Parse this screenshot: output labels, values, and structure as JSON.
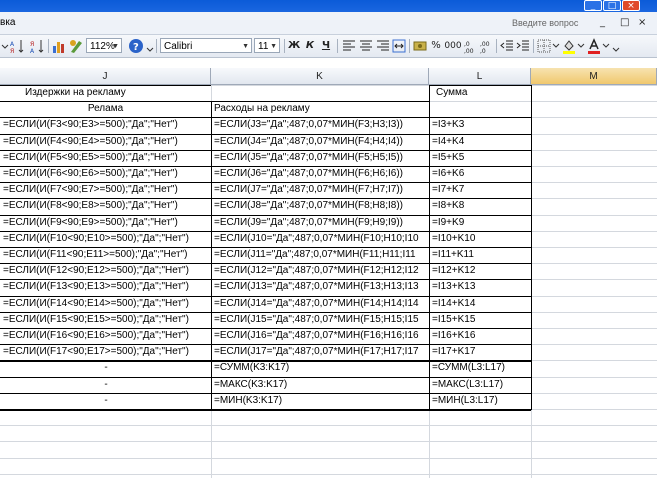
{
  "window": {
    "menu_partial_label": "вка",
    "min": "_",
    "max": "□",
    "close": "×"
  },
  "menubar": {
    "help_placeholder": "Введите вопрос",
    "doc_min": "_",
    "doc_restore": "□",
    "doc_close": "×"
  },
  "toolbar": {
    "zoom": "112%",
    "font_name": "Calibri",
    "font_size": "11",
    "bold": "Ж",
    "italic": "К",
    "underline": "Ч",
    "percent": "%",
    "thousands": "000",
    "help_glyph": "?"
  },
  "columns": [
    {
      "letter": "J"
    },
    {
      "letter": "K"
    },
    {
      "letter": "L"
    },
    {
      "letter": "M"
    }
  ],
  "header_rows": {
    "j1": "Издержки на рекламу",
    "l1": "Сумма",
    "j2": "Релама",
    "k2": "Расходы на рекламу"
  },
  "rows": [
    {
      "j": "=ЕСЛИ(И(F3<90;E3>=500);\"Да\";\"Нет\")",
      "k": "=ЕСЛИ(J3=\"Да\";487;0,07*МИН(F3;H3;I3))",
      "l": "=I3+K3"
    },
    {
      "j": "=ЕСЛИ(И(F4<90;E4>=500);\"Да\";\"Нет\")",
      "k": "=ЕСЛИ(J4=\"Да\";487;0,07*МИН(F4;H4;I4))",
      "l": "=I4+K4"
    },
    {
      "j": "=ЕСЛИ(И(F5<90;E5>=500);\"Да\";\"Нет\")",
      "k": "=ЕСЛИ(J5=\"Да\";487;0,07*МИН(F5;H5;I5))",
      "l": "=I5+K5"
    },
    {
      "j": "=ЕСЛИ(И(F6<90;E6>=500);\"Да\";\"Нет\")",
      "k": "=ЕСЛИ(J6=\"Да\";487;0,07*МИН(F6;H6;I6))",
      "l": "=I6+K6"
    },
    {
      "j": "=ЕСЛИ(И(F7<90;E7>=500);\"Да\";\"Нет\")",
      "k": "=ЕСЛИ(J7=\"Да\";487;0,07*МИН(F7;H7;I7))",
      "l": "=I7+K7"
    },
    {
      "j": "=ЕСЛИ(И(F8<90;E8>=500);\"Да\";\"Нет\")",
      "k": "=ЕСЛИ(J8=\"Да\";487;0,07*МИН(F8;H8;I8))",
      "l": "=I8+K8"
    },
    {
      "j": "=ЕСЛИ(И(F9<90;E9>=500);\"Да\";\"Нет\")",
      "k": "=ЕСЛИ(J9=\"Да\";487;0,07*МИН(F9;H9;I9))",
      "l": "=I9+K9"
    },
    {
      "j": "=ЕСЛИ(И(F10<90;E10>=500);\"Да\";\"Нет\")",
      "k": "=ЕСЛИ(J10=\"Да\";487;0,07*МИН(F10;H10;I10",
      "l": "=I10+K10"
    },
    {
      "j": "=ЕСЛИ(И(F11<90;E11>=500);\"Да\";\"Нет\")",
      "k": "=ЕСЛИ(J11=\"Да\";487;0,07*МИН(F11;H11;I11",
      "l": "=I11+K11"
    },
    {
      "j": "=ЕСЛИ(И(F12<90;E12>=500);\"Да\";\"Нет\")",
      "k": "=ЕСЛИ(J12=\"Да\";487;0,07*МИН(F12;H12;I12",
      "l": "=I12+K12"
    },
    {
      "j": "=ЕСЛИ(И(F13<90;E13>=500);\"Да\";\"Нет\")",
      "k": "=ЕСЛИ(J13=\"Да\";487;0,07*МИН(F13;H13;I13",
      "l": "=I13+K13"
    },
    {
      "j": "=ЕСЛИ(И(F14<90;E14>=500);\"Да\";\"Нет\")",
      "k": "=ЕСЛИ(J14=\"Да\";487;0,07*МИН(F14;H14;I14",
      "l": "=I14+K14"
    },
    {
      "j": "=ЕСЛИ(И(F15<90;E15>=500);\"Да\";\"Нет\")",
      "k": "=ЕСЛИ(J15=\"Да\";487;0,07*МИН(F15;H15;I15",
      "l": "=I15+K15"
    },
    {
      "j": "=ЕСЛИ(И(F16<90;E16>=500);\"Да\";\"Нет\")",
      "k": "=ЕСЛИ(J16=\"Да\";487;0,07*МИН(F16;H16;I16",
      "l": "=I16+K16"
    },
    {
      "j": "=ЕСЛИ(И(F17<90;E17>=500);\"Да\";\"Нет\")",
      "k": "=ЕСЛИ(J17=\"Да\";487;0,07*МИН(F17;H17;I17",
      "l": "=I17+K17"
    }
  ],
  "summary_rows": [
    {
      "j": "-",
      "k": "=СУММ(K3:K17)",
      "l": "=СУММ(L3:L17)"
    },
    {
      "j": "-",
      "k": "=МАКС(K3:K17)",
      "l": "=МАКС(L3:L17)"
    },
    {
      "j": "-",
      "k": "=МИН(K3:K17)",
      "l": "=МИН(L3:L17)"
    }
  ]
}
